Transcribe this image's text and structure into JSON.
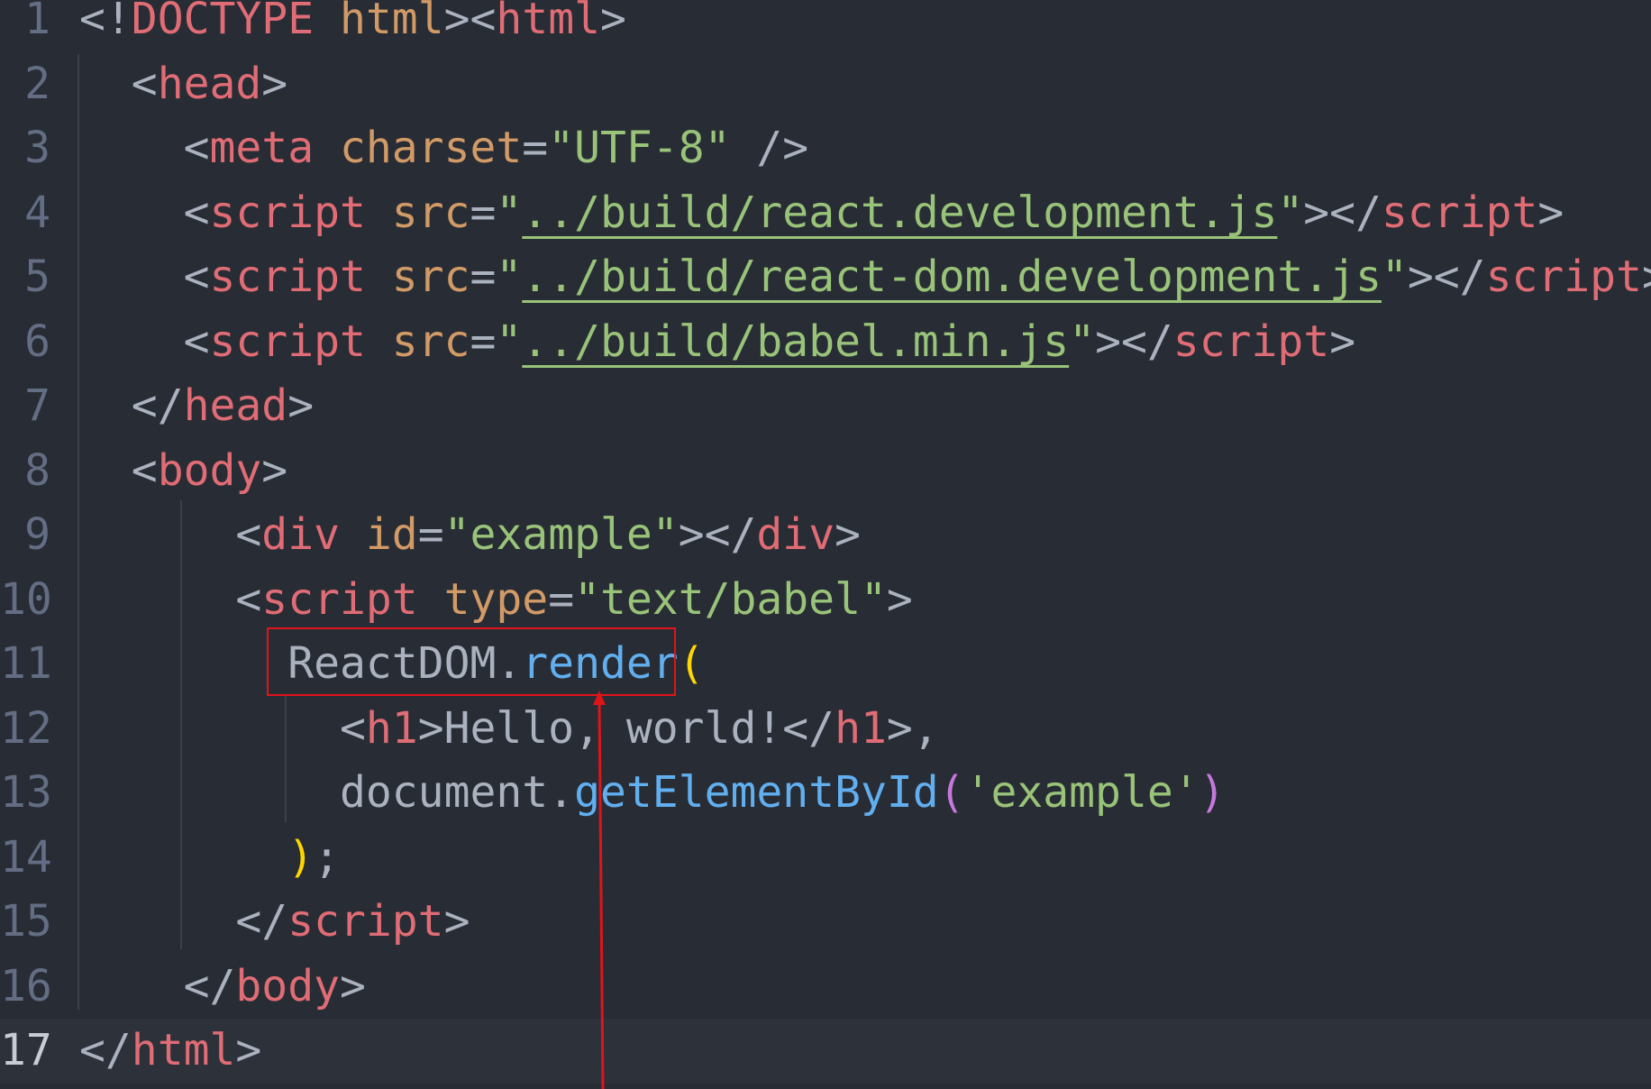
{
  "editor": {
    "lines": [
      {
        "n": "1",
        "parts": [
          [
            "p",
            "<!"
          ],
          [
            "t",
            "DOCTYPE"
          ],
          [
            "p",
            " "
          ],
          [
            "a",
            "html"
          ],
          [
            "p",
            "><"
          ],
          [
            "t",
            "html"
          ],
          [
            "p",
            ">"
          ]
        ]
      },
      {
        "n": "2",
        "parts": [
          [
            "p",
            "  <"
          ],
          [
            "t",
            "head"
          ],
          [
            "p",
            ">"
          ]
        ]
      },
      {
        "n": "3",
        "parts": [
          [
            "p",
            "    <"
          ],
          [
            "t",
            "meta"
          ],
          [
            "p",
            " "
          ],
          [
            "a",
            "charset"
          ],
          [
            "p",
            "="
          ],
          [
            "s",
            "\"UTF-8\""
          ],
          [
            "p",
            " />"
          ]
        ]
      },
      {
        "n": "4",
        "parts": [
          [
            "p",
            "    <"
          ],
          [
            "t",
            "script"
          ],
          [
            "p",
            " "
          ],
          [
            "a",
            "src"
          ],
          [
            "p",
            "="
          ],
          [
            "s",
            "\""
          ],
          [
            "su",
            "../build/react.development.js"
          ],
          [
            "s",
            "\""
          ],
          [
            "p",
            "></"
          ],
          [
            "t",
            "script"
          ],
          [
            "p",
            ">"
          ]
        ]
      },
      {
        "n": "5",
        "parts": [
          [
            "p",
            "    <"
          ],
          [
            "t",
            "script"
          ],
          [
            "p",
            " "
          ],
          [
            "a",
            "src"
          ],
          [
            "p",
            "="
          ],
          [
            "s",
            "\""
          ],
          [
            "su",
            "../build/react-dom.development.js"
          ],
          [
            "s",
            "\""
          ],
          [
            "p",
            "></"
          ],
          [
            "t",
            "script"
          ],
          [
            "p",
            ">"
          ]
        ]
      },
      {
        "n": "6",
        "parts": [
          [
            "p",
            "    <"
          ],
          [
            "t",
            "script"
          ],
          [
            "p",
            " "
          ],
          [
            "a",
            "src"
          ],
          [
            "p",
            "="
          ],
          [
            "s",
            "\""
          ],
          [
            "su",
            "../build/babel.min.js"
          ],
          [
            "s",
            "\""
          ],
          [
            "p",
            "></"
          ],
          [
            "t",
            "script"
          ],
          [
            "p",
            ">"
          ]
        ]
      },
      {
        "n": "7",
        "parts": [
          [
            "p",
            "  </"
          ],
          [
            "t",
            "head"
          ],
          [
            "p",
            ">"
          ]
        ]
      },
      {
        "n": "8",
        "parts": [
          [
            "p",
            "  <"
          ],
          [
            "t",
            "body"
          ],
          [
            "p",
            ">"
          ]
        ]
      },
      {
        "n": "9",
        "parts": [
          [
            "p",
            "      <"
          ],
          [
            "t",
            "div"
          ],
          [
            "p",
            " "
          ],
          [
            "a",
            "id"
          ],
          [
            "p",
            "="
          ],
          [
            "s",
            "\"example\""
          ],
          [
            "p",
            "></"
          ],
          [
            "t",
            "div"
          ],
          [
            "p",
            ">"
          ]
        ]
      },
      {
        "n": "10",
        "parts": [
          [
            "p",
            "      <"
          ],
          [
            "t",
            "script"
          ],
          [
            "p",
            " "
          ],
          [
            "a",
            "type"
          ],
          [
            "p",
            "="
          ],
          [
            "s",
            "\"text/babel\""
          ],
          [
            "p",
            ">"
          ]
        ]
      },
      {
        "n": "11",
        "parts": [
          [
            "p",
            "        ReactDOM."
          ],
          [
            "f",
            "render"
          ],
          [
            "gold",
            "("
          ]
        ]
      },
      {
        "n": "12",
        "parts": [
          [
            "p",
            "          <"
          ],
          [
            "t",
            "h1"
          ],
          [
            "p",
            ">Hello, world!</"
          ],
          [
            "t",
            "h1"
          ],
          [
            "p",
            ">,"
          ]
        ]
      },
      {
        "n": "13",
        "parts": [
          [
            "p",
            "          document."
          ],
          [
            "f",
            "getElementById"
          ],
          [
            "pu",
            "("
          ],
          [
            "s",
            "'example'"
          ],
          [
            "pu",
            ")"
          ]
        ]
      },
      {
        "n": "14",
        "parts": [
          [
            "p",
            "        "
          ],
          [
            "gold",
            ")"
          ],
          [
            "p",
            ";"
          ]
        ]
      },
      {
        "n": "15",
        "parts": [
          [
            "p",
            "      </"
          ],
          [
            "t",
            "script"
          ],
          [
            "p",
            ">"
          ]
        ]
      },
      {
        "n": "16",
        "parts": [
          [
            "p",
            "    </"
          ],
          [
            "t",
            "body"
          ],
          [
            "p",
            ">"
          ]
        ]
      },
      {
        "n": "17",
        "parts": [
          [
            "p",
            "</"
          ],
          [
            "t",
            "html"
          ],
          [
            "p",
            ">"
          ]
        ]
      }
    ],
    "current_line": "17"
  },
  "colors": {
    "background": "#282c34",
    "tag": "#e06c75",
    "attribute": "#d19a66",
    "string": "#98c379",
    "function": "#61afef",
    "annotation": "#e0141b"
  }
}
